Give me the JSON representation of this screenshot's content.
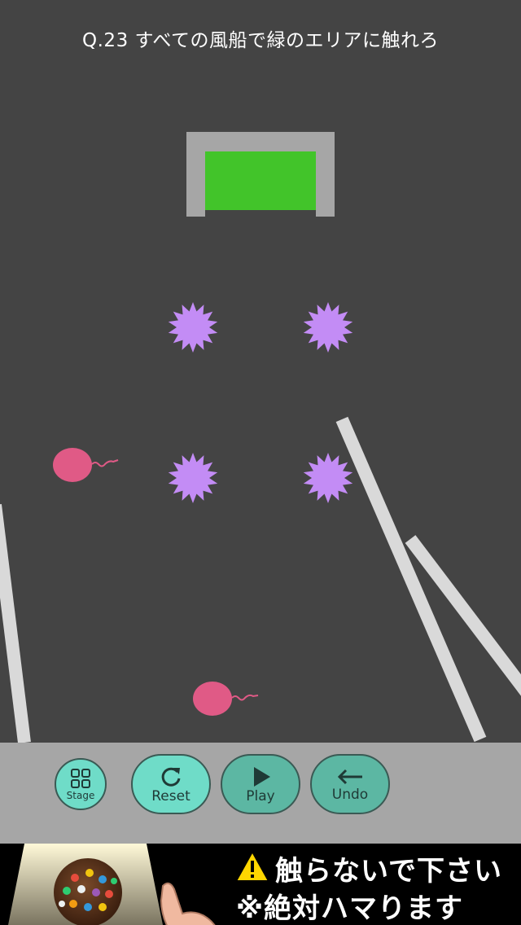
{
  "level": {
    "title": "Q.23 すべての風船で緑のエリアに触れろ"
  },
  "colors": {
    "background": "#444444",
    "goal_green": "#42c42a",
    "goal_frame": "#a6a6a6",
    "spike": "#c38cf5",
    "balloon": "#e05a86",
    "ramp": "#d9d9d9",
    "toolbar": "#a6a6a6",
    "button_light": "#6fdcc8",
    "button_dark": "#5cb7a3"
  },
  "toolbar": {
    "stage_label": "Stage",
    "reset_label": "Reset",
    "play_label": "Play",
    "undo_label": "Undo",
    "stage_icon": "grid-icon",
    "reset_icon": "refresh-icon",
    "play_icon": "play-icon",
    "undo_icon": "arrow-left-icon"
  },
  "ad": {
    "line1": "触らないで下さい",
    "line2": "※絶対ハマります"
  }
}
